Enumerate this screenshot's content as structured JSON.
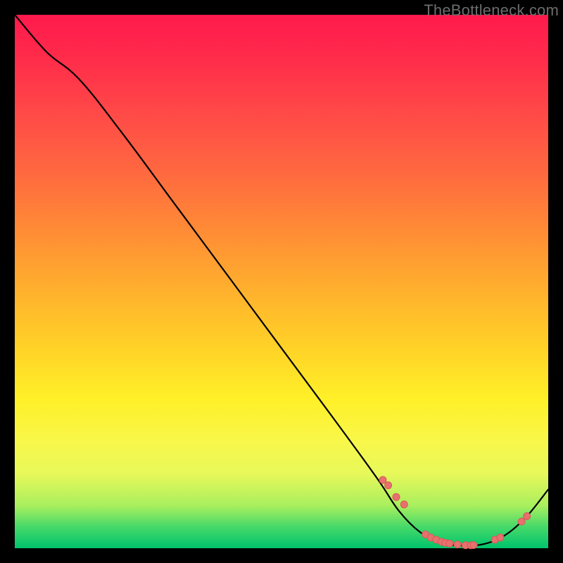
{
  "watermark": "TheBottleneck.com",
  "colors": {
    "curve": "#000000",
    "point_fill": "#e6716f",
    "point_stroke": "#d95a57"
  },
  "chart_data": {
    "type": "line",
    "title": "",
    "xlabel": "",
    "ylabel": "",
    "xlim": [
      0,
      100
    ],
    "ylim": [
      0,
      100
    ],
    "grid": false,
    "legend": false,
    "series": [
      {
        "name": "curve",
        "x": [
          0,
          6,
          12,
          20,
          30,
          40,
          50,
          60,
          68,
          72,
          76,
          80,
          84,
          88,
          92,
          96,
          100
        ],
        "y": [
          100,
          93,
          88,
          78,
          64.5,
          51,
          37.5,
          24,
          13,
          7,
          3,
          1,
          0.5,
          0.8,
          2.5,
          6,
          11
        ]
      }
    ],
    "highlight_points": {
      "x": [
        69,
        70,
        71.5,
        73,
        77,
        78,
        79,
        80,
        80.7,
        81.5,
        83,
        84.5,
        85.5,
        86,
        90,
        91,
        95,
        96
      ],
      "y": [
        12.8,
        11.8,
        9.6,
        8.2,
        2.6,
        2.0,
        1.6,
        1.2,
        1.0,
        0.9,
        0.7,
        0.55,
        0.55,
        0.6,
        1.6,
        2.0,
        5.0,
        6.0
      ]
    }
  }
}
